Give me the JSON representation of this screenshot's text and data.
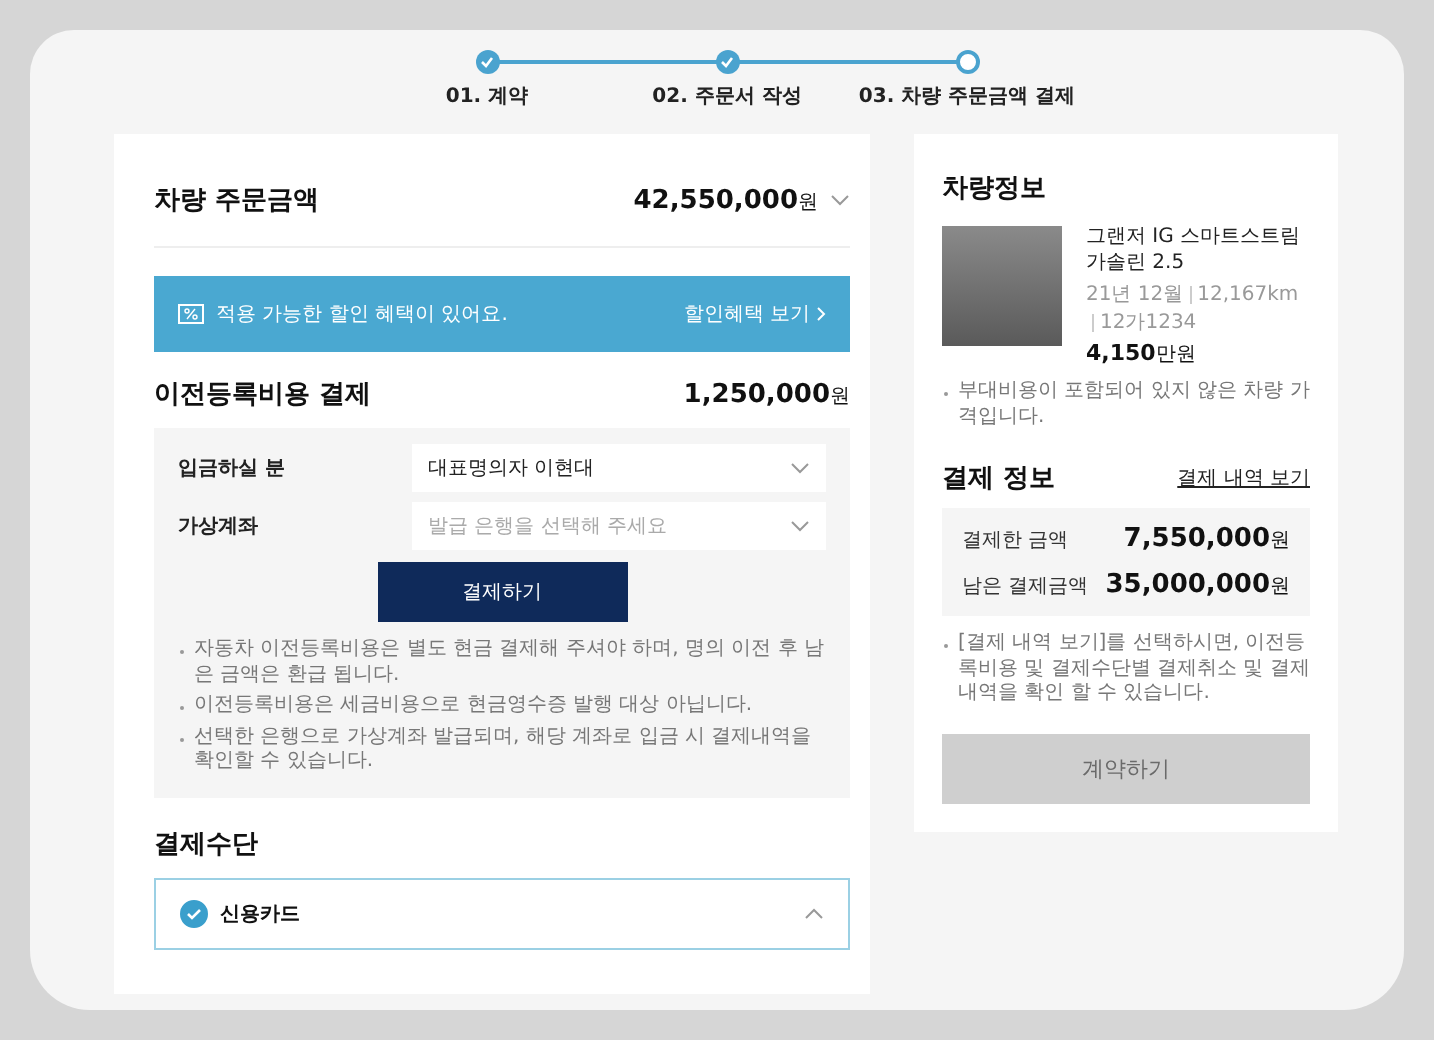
{
  "steps": [
    {
      "label": "01. 계약",
      "completed": true
    },
    {
      "label": "02. 주문서 작성",
      "completed": true
    },
    {
      "label": "03. 차량 주문금액 결제",
      "completed": false
    }
  ],
  "order": {
    "title": "차량 주문금액",
    "amount": "42,550,000",
    "unit": "원",
    "expanded": false
  },
  "discount_banner": {
    "text": "적용 가능한 할인 혜택이 있어요.",
    "link": "할인혜택 보기"
  },
  "registration": {
    "title": "이전등록비용 결제",
    "amount": "1,250,000",
    "unit": "원",
    "fields": [
      {
        "label": "입금하실 분",
        "value": "대표명의자 이현대"
      },
      {
        "label": "가상계좌",
        "placeholder": "발급 은행을 선택해 주세요"
      }
    ],
    "button": {
      "label": "결제하기",
      "disabled": false
    },
    "notes": [
      "자동차 이전등록비용은 별도 현금 결제해 주셔야 하며, 명의 이전 후 남은 금액은 환급 됩니다.",
      "이전등록비용은 세금비용으로 현금영수증 발행 대상 아닙니다.",
      "선택한 은행으로 가상계좌 발급되며, 해당 계좌로 입금 시 결제내역을 확인할 수 있습니다."
    ]
  },
  "payment_method": {
    "title": "결제수단",
    "options": [
      {
        "label": "신용카드",
        "selected": true,
        "expanded": true
      }
    ]
  },
  "vehicle": {
    "title": "차량정보",
    "name": "그랜저 IG 스마트스트림 가솔린 2.5",
    "specs": [
      "21년 12월",
      "12,167km",
      "12가1234"
    ],
    "price": "4,150",
    "price_unit": "만원",
    "note": "부대비용이 포함되어 있지 않은 차량 가격입니다."
  },
  "payment_info": {
    "title": "결제 정보",
    "link": "결제 내역 보기",
    "rows": [
      {
        "label": "결제한 금액",
        "amount": "7,550,000",
        "unit": "원"
      },
      {
        "label": "남은 결제금액",
        "amount": "35,000,000",
        "unit": "원"
      }
    ],
    "note": "[결제 내역 보기]를 선택하시면, 이전등록비용 및 결제수단별 결제취소 및 결제내역을 확인 할 수 있습니다."
  },
  "contract_button": {
    "label": "계약하기",
    "disabled": true
  }
}
